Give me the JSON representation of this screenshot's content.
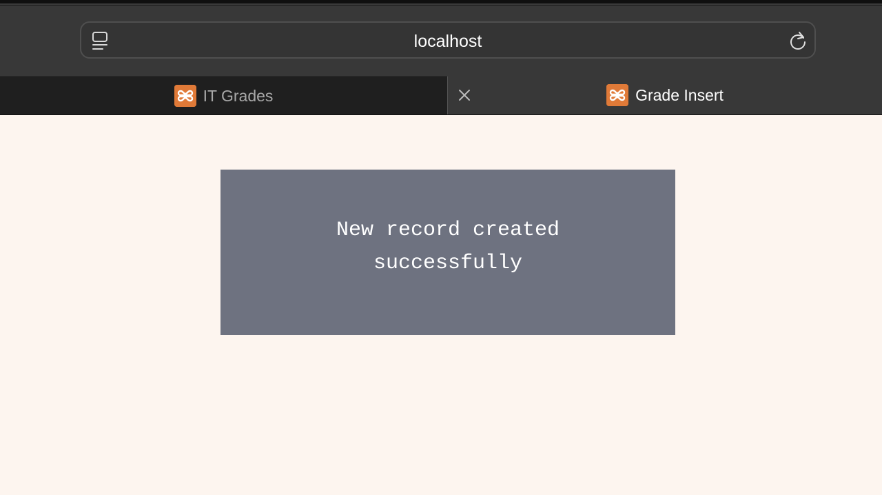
{
  "browser": {
    "address_bar": {
      "url": "localhost",
      "sidebar_icon": "sidebar-icon",
      "reload_icon": "reload-icon"
    },
    "tabs": [
      {
        "label": "IT Grades",
        "favicon": "xampp-icon",
        "active": false
      },
      {
        "label": "Grade Insert",
        "favicon": "xampp-icon",
        "active": true,
        "close_icon": "close-icon"
      }
    ]
  },
  "page": {
    "message": "New record created successfully",
    "background_color": "#fdf5ef",
    "message_box_color": "#6e7280",
    "favicon_color": "#e07a38"
  }
}
